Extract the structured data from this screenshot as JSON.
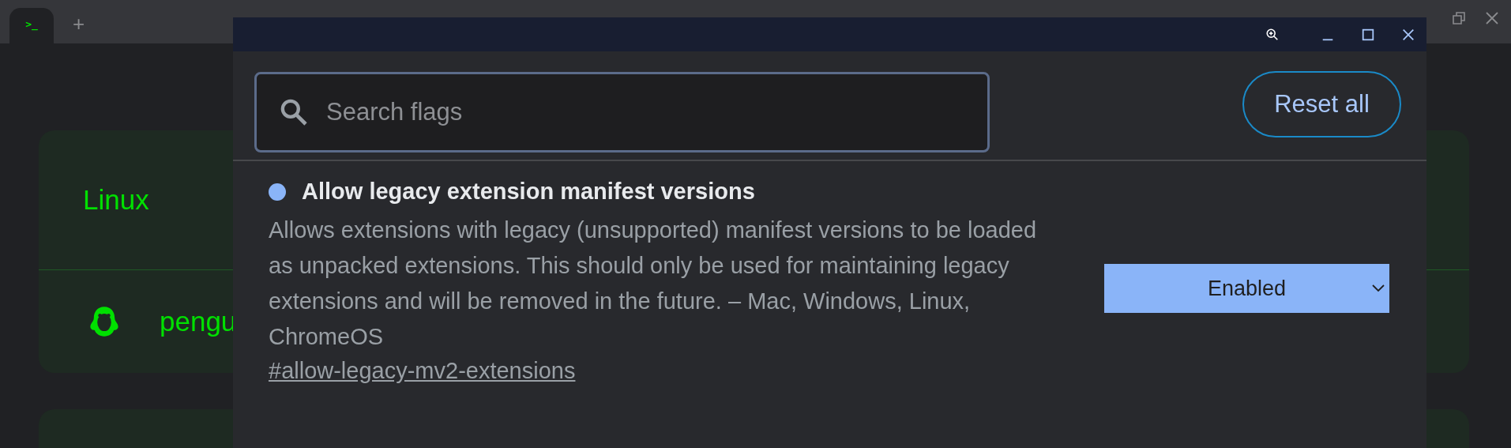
{
  "tab_strip": {
    "tabs": [
      {
        "label": ">_",
        "selected": true
      }
    ],
    "new_tab": "+"
  },
  "background": {
    "cards": [
      {
        "title": "Linux",
        "rows": [
          {
            "label": "pengu"
          }
        ]
      }
    ]
  },
  "dialog": {
    "search": {
      "placeholder": "Search flags"
    },
    "reset_button": "Reset all",
    "flags": [
      {
        "title": "Allow legacy extension manifest versions",
        "modified": true,
        "description": "Allows extensions with legacy (unsupported) manifest versions to be loaded as unpacked extensions. This should only be used for maintaining legacy extensions and will be removed in the future. – Mac, Windows, Linux, ChromeOS",
        "link": "#allow-legacy-mv2-extensions",
        "value": "Enabled"
      }
    ]
  }
}
